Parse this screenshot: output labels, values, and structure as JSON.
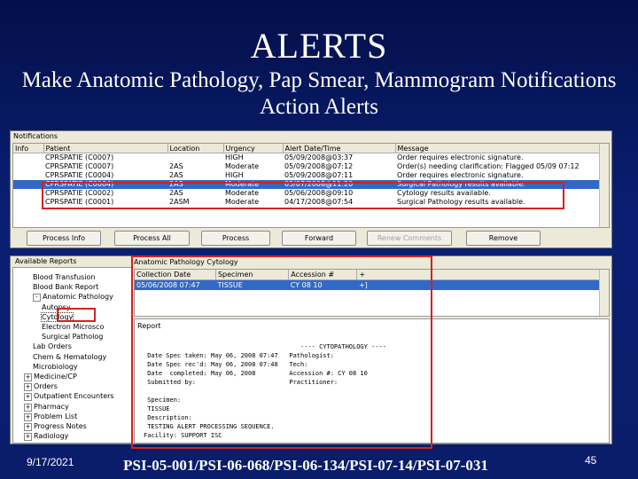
{
  "slide": {
    "title": "ALERTS",
    "subtitle": "Make Anatomic Pathology, Pap Smear, Mammogram Notifications Action Alerts",
    "date": "9/17/2021",
    "reference": "PSI-05-001/PSI-06-068/PSI-06-134/PSI-07-14/PSI-07-031",
    "page": "45"
  },
  "notifications": {
    "title": "Notifications",
    "columns": [
      "Info",
      "Patient",
      "Location",
      "Urgency",
      "Alert Date/Time",
      "Message"
    ],
    "rows": [
      {
        "info": "",
        "patient": "CPRSPATIE (C0007)",
        "location": "",
        "urgency": "HIGH",
        "datetime": "05/09/2008@03:37",
        "message": "Order requires electronic signature.",
        "selected": false
      },
      {
        "info": "",
        "patient": "CPRSPATIE (C0007)",
        "location": "2AS",
        "urgency": "Moderate",
        "datetime": "05/09/2008@07:12",
        "message": "Order(s) needing clarification: Flagged 05/09 07:12",
        "selected": false
      },
      {
        "info": "",
        "patient": "CPRSPATIE (C0004)",
        "location": "2AS",
        "urgency": "HIGH",
        "datetime": "05/09/2008@07:11",
        "message": "Order requires electronic signature.",
        "selected": false
      },
      {
        "info": "",
        "patient": "CPRSPATIE (C0004)",
        "location": "2AS",
        "urgency": "Moderate",
        "datetime": "05/07/2008@11:20",
        "message": "Surgical Pathology results available.",
        "selected": true
      },
      {
        "info": "",
        "patient": "CPRSPATIE (C0002)",
        "location": "2AS",
        "urgency": "Moderate",
        "datetime": "05/06/2008@09:10",
        "message": "Cytology results available.",
        "selected": false
      },
      {
        "info": "",
        "patient": "CPRSPATIE (C0001)",
        "location": "2ASM",
        "urgency": "Moderate",
        "datetime": "04/17/2008@07:54",
        "message": "Surgical Pathology results available.",
        "selected": false
      }
    ],
    "buttons": [
      {
        "label": "Process Info",
        "disabled": false
      },
      {
        "label": "Process All",
        "disabled": false
      },
      {
        "label": "Process",
        "disabled": false
      },
      {
        "label": "Forward",
        "disabled": false
      },
      {
        "label": "Renew Comments",
        "disabled": true
      },
      {
        "label": "Remove",
        "disabled": false
      }
    ]
  },
  "tree": {
    "title": "Available Reports",
    "items": [
      {
        "label": "Blood Transfusion",
        "indent": 2,
        "expander": ""
      },
      {
        "label": "Blood Bank Report",
        "indent": 2,
        "expander": ""
      },
      {
        "label": "Anatomic Pathology",
        "indent": 2,
        "expander": "-"
      },
      {
        "label": "Autopsy",
        "indent": 3,
        "expander": ""
      },
      {
        "label": "Cytology",
        "indent": 3,
        "expander": "",
        "selected": true
      },
      {
        "label": "Electron Microsco",
        "indent": 3,
        "expander": ""
      },
      {
        "label": "Surgical Patholog",
        "indent": 3,
        "expander": ""
      },
      {
        "label": "Lab Orders",
        "indent": 2,
        "expander": ""
      },
      {
        "label": "Chem & Hematology",
        "indent": 2,
        "expander": ""
      },
      {
        "label": "Microbiology",
        "indent": 2,
        "expander": ""
      },
      {
        "label": "Medicine/CP",
        "indent": 1,
        "expander": "+"
      },
      {
        "label": "Orders",
        "indent": 1,
        "expander": "+"
      },
      {
        "label": "Outpatient Encounters",
        "indent": 1,
        "expander": "+"
      },
      {
        "label": "Pharmacy",
        "indent": 1,
        "expander": "+"
      },
      {
        "label": "Problem List",
        "indent": 1,
        "expander": "+"
      },
      {
        "label": "Progress Notes",
        "indent": 1,
        "expander": "+"
      },
      {
        "label": "Radiology",
        "indent": 1,
        "expander": "+"
      }
    ]
  },
  "cytology": {
    "title": "Anatomic Pathology Cytology",
    "columns": [
      "Collection Date",
      "Specimen",
      "Accession #",
      "+"
    ],
    "rows": [
      {
        "date": "05/06/2008 07:47",
        "specimen": "TISSUE",
        "accession": "CY 08 10",
        "flag": "+]"
      }
    ],
    "report_label": "Report",
    "report_text": "                                          ---- CYTOPATHOLOGY ----\n Date Spec taken: May 06, 2008 07:47   Pathologist:\n Date Spec rec'd: May 06, 2008 07:48   Tech:\n Date  completed: May 06, 2008         Accession #: CY 08 10\n Submitted by:                         Practitioner:\n\n Specimen:\n TISSUE\n Description:\n TESTING ALERT PROCESSING SEQUENCE.\nFacility: SUPPORT ISC"
  }
}
